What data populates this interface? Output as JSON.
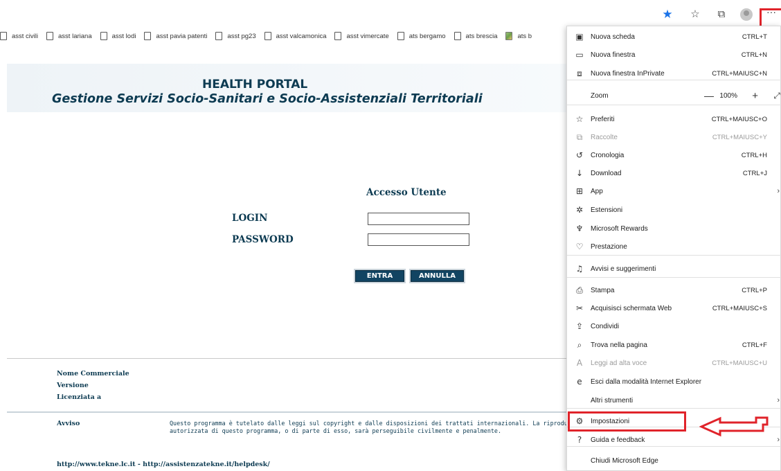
{
  "toolbar": {
    "icons": [
      "star-icon",
      "favorites-icon",
      "collections-icon",
      "profile-avatar",
      "more-icon"
    ],
    "more_label": "···"
  },
  "bookmarks": [
    {
      "label": "asst civili",
      "icon": "page-icon"
    },
    {
      "label": "asst lariana",
      "icon": "page-icon"
    },
    {
      "label": "asst lodi",
      "icon": "page-icon"
    },
    {
      "label": "asst pavia patenti",
      "icon": "page-icon"
    },
    {
      "label": "asst pg23",
      "icon": "page-icon"
    },
    {
      "label": "asst valcamonica",
      "icon": "page-icon"
    },
    {
      "label": "asst vimercate",
      "icon": "page-icon"
    },
    {
      "label": "ats bergamo",
      "icon": "page-icon"
    },
    {
      "label": "ats brescia",
      "icon": "page-icon"
    },
    {
      "label": "ats b",
      "icon": "image-icon"
    }
  ],
  "page": {
    "title": "HEALTH PORTAL",
    "subtitle": "Gestione Servizi Socio-Sanitari e Socio-Assistenziali Territoriali",
    "access_title": "Accesso Utente",
    "login_label": "LOGIN",
    "password_label": "PASSWORD",
    "login_value": "",
    "password_value": "",
    "enter_button": "ENTRA",
    "cancel_button": "ANNULLA",
    "meta": {
      "nome_commerciale": "Nome Commerciale",
      "versione": "Versione",
      "licenziata_a": "Licenziata a"
    },
    "avviso_label": "Avviso",
    "avviso_line1": "Questo programma è tutelato dalle leggi sul copyright e dalle disposizioni dei trattati internazionali. La riproduzione o d",
    "avviso_line2": "autorizzata di questo programma, o di parte di esso, sarà perseguibile civilmente e penalmente.",
    "footer_links": "http://www.tekne.lc.it - http://assistenzatekne.it/helpdesk/"
  },
  "menu": {
    "items": [
      {
        "label": "Nuova scheda",
        "shortcut": "CTRL+T",
        "icon": "new-tab-icon"
      },
      {
        "label": "Nuova finestra",
        "shortcut": "CTRL+N",
        "icon": "new-window-icon"
      },
      {
        "label": "Nuova finestra InPrivate",
        "shortcut": "CTRL+MAIUSC+N",
        "icon": "inprivate-icon"
      },
      {
        "label": "Zoom",
        "zoom_value": "100%",
        "icon": ""
      },
      {
        "label": "Preferiti",
        "shortcut": "CTRL+MAIUSC+O",
        "icon": "favorites-icon"
      },
      {
        "label": "Raccolte",
        "shortcut": "CTRL+MAIUSC+Y",
        "icon": "collections-icon",
        "disabled": true
      },
      {
        "label": "Cronologia",
        "shortcut": "CTRL+H",
        "icon": "history-icon"
      },
      {
        "label": "Download",
        "shortcut": "CTRL+J",
        "icon": "download-icon"
      },
      {
        "label": "App",
        "icon": "apps-icon",
        "submenu": true
      },
      {
        "label": "Estensioni",
        "icon": "extensions-icon"
      },
      {
        "label": "Microsoft Rewards",
        "icon": "rewards-icon"
      },
      {
        "label": "Prestazione",
        "icon": "performance-icon"
      },
      {
        "label": "Avvisi e suggerimenti",
        "icon": "bell-icon"
      },
      {
        "label": "Stampa",
        "shortcut": "CTRL+P",
        "icon": "print-icon"
      },
      {
        "label": "Acquisisci schermata Web",
        "shortcut": "CTRL+MAIUSC+S",
        "icon": "web-capture-icon"
      },
      {
        "label": "Condividi",
        "icon": "share-icon"
      },
      {
        "label": "Trova nella pagina",
        "shortcut": "CTRL+F",
        "icon": "find-icon"
      },
      {
        "label": "Leggi ad alta voce",
        "shortcut": "CTRL+MAIUSC+U",
        "icon": "read-aloud-icon",
        "disabled": true
      },
      {
        "label": "Esci dalla modalità Internet Explorer",
        "icon": "ie-mode-icon"
      },
      {
        "label": "Altri strumenti",
        "icon": "",
        "submenu": true
      },
      {
        "label": "Impostazioni",
        "icon": "gear-icon"
      },
      {
        "label": "Guida e feedback",
        "icon": "help-icon",
        "submenu": true
      },
      {
        "label": "Chiudi Microsoft Edge",
        "icon": ""
      }
    ]
  },
  "colors": {
    "highlight": "#e0232a",
    "portal_text": "#0d3b52",
    "button_bg": "#124462"
  }
}
